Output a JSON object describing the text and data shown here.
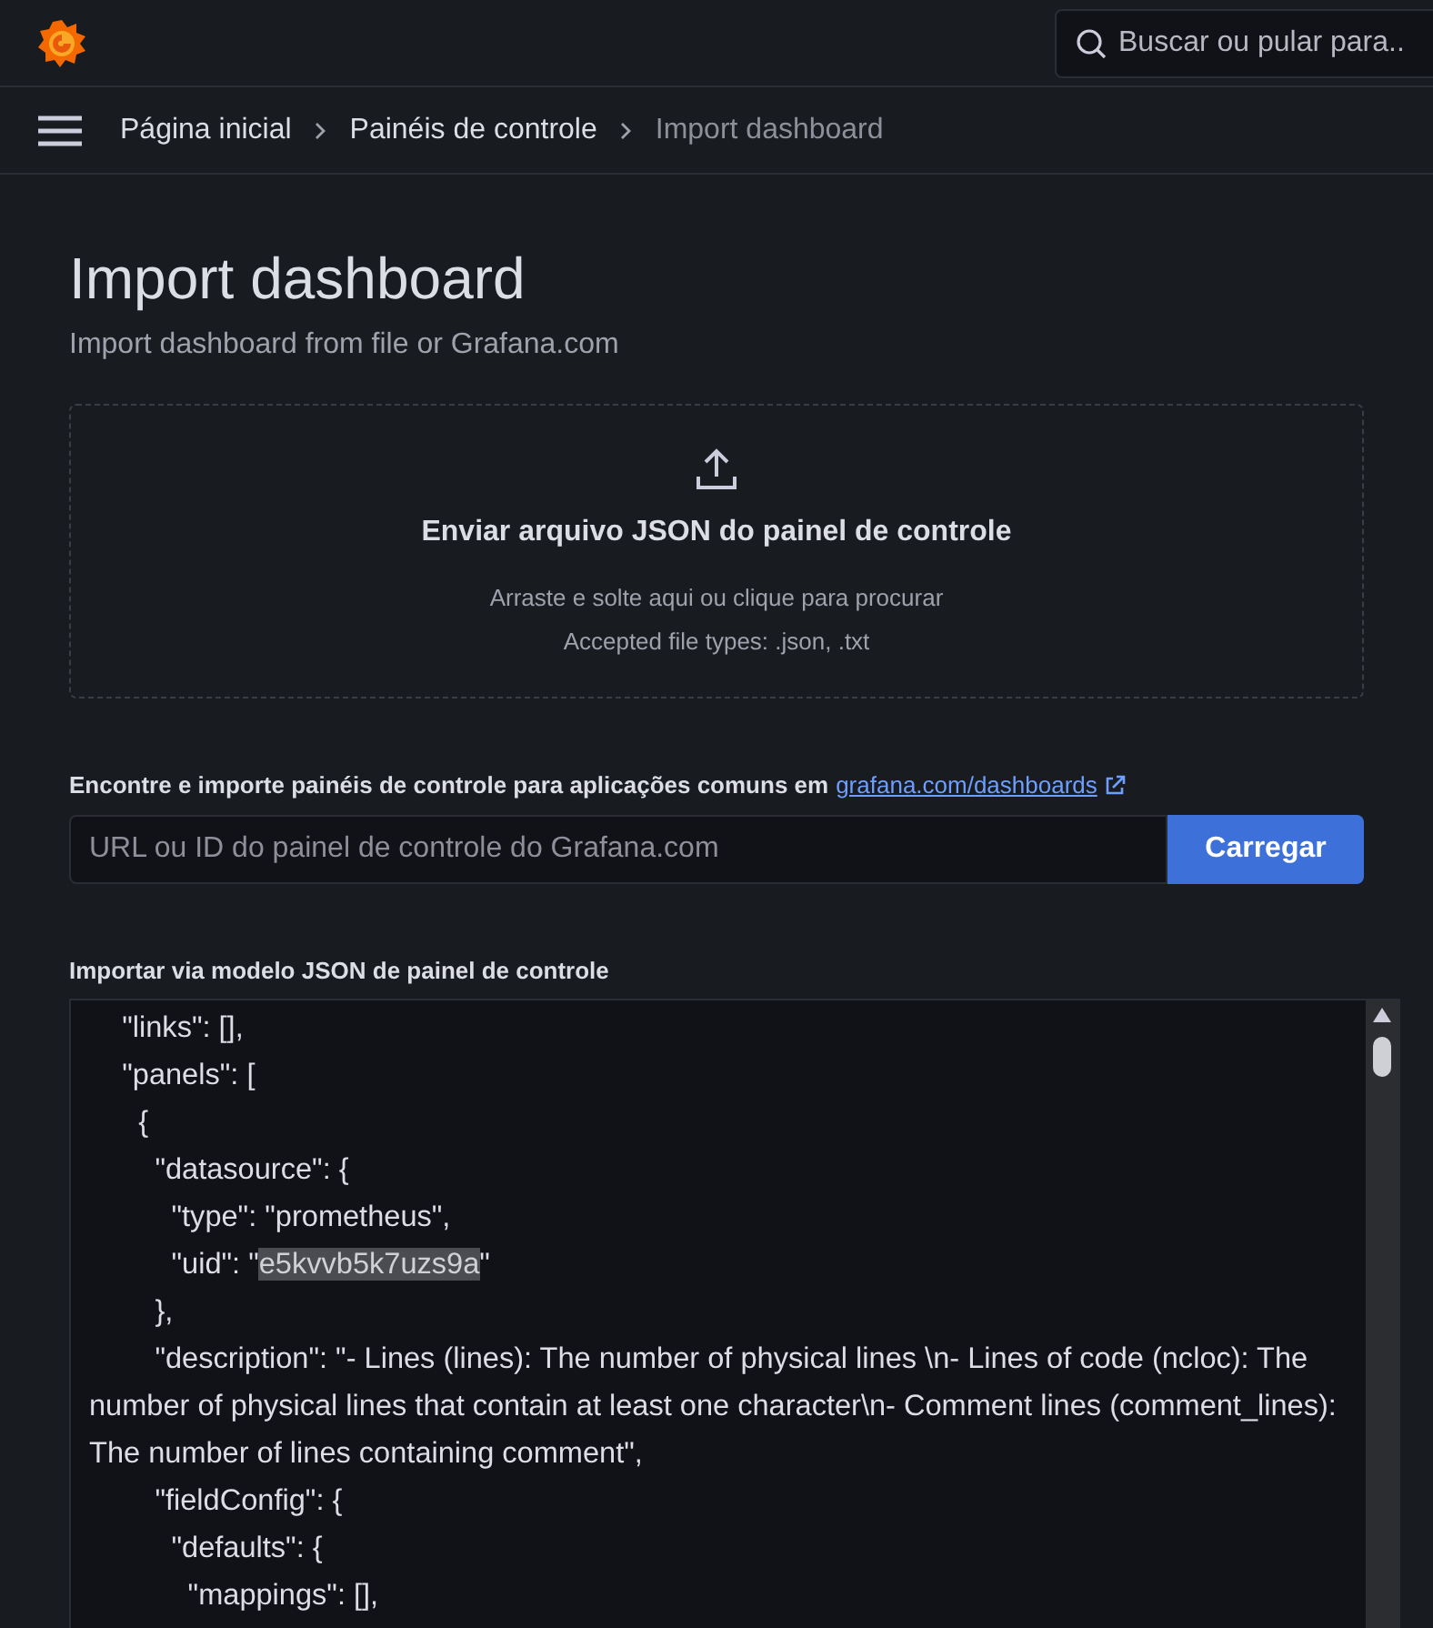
{
  "top_bar": {
    "search": {
      "placeholder": "Buscar ou pular para.."
    }
  },
  "breadcrumbs": [
    {
      "label": "Página inicial",
      "current": false
    },
    {
      "label": "Painéis de controle",
      "current": false
    },
    {
      "label": "Import dashboard",
      "current": true
    }
  ],
  "page": {
    "title": "Import dashboard",
    "subtitle": "Import dashboard from file or Grafana.com"
  },
  "upload": {
    "title": "Enviar arquivo JSON do painel de controle",
    "hint": "Arraste e solte aqui ou clique para procurar",
    "accepted": "Accepted file types: .json, .txt"
  },
  "grafana_com": {
    "label": "Encontre e importe painéis de controle para aplicações comuns em",
    "link": "grafana.com/dashboards",
    "placeholder": "URL ou ID do painel de controle do Grafana.com",
    "button": "Carregar"
  },
  "json_model": {
    "label": "Importar via modelo JSON de painel de controle",
    "lines": [
      {
        "text": "    \"links\": [],"
      },
      {
        "text": "    \"panels\": ["
      },
      {
        "text": "      {"
      },
      {
        "text": "        \"datasource\": {"
      },
      {
        "text": "          \"type\": \"prometheus\","
      },
      {
        "text": "          \"uid\": \"",
        "selection": "e5kvvb5k7uzs9a",
        "after": "\""
      },
      {
        "text": "        },"
      },
      {
        "text": "        \"description\": \"- Lines (lines): The number of physical lines \\n- Lines of code (ncloc): The number of physical lines that contain at least one character\\n- Comment lines (comment_lines): The number of lines containing comment\","
      },
      {
        "text": "        \"fieldConfig\": {"
      },
      {
        "text": "          \"defaults\": {"
      },
      {
        "text": "            \"mappings\": [],"
      }
    ]
  }
}
